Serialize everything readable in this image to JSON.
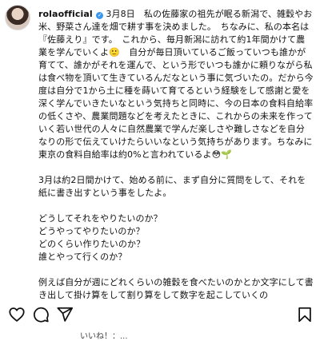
{
  "post": {
    "username": "rolaofficial",
    "date": "3月8日",
    "intro": "私の佐藤家の祖先が眠る新潟で、雑穀やお米、野菜さん達を畑で耕す事を決めました。　ちなみに、私の本名は『佐藤えり』です。　これから、毎月新潟に訪れて約1年間かけて農業を学んでいくよ",
    "emoji_1": "🙂",
    "body": "　自分が毎日頂いているご飯っていつも誰かが育てて、誰かがそれを運んで、という形でいつも誰かに頼りながら私は食べ物を頂いて生きているんだなという事に気づいたの。だから今度は自分で1から土に種を蒔いて育てるという経験をして感謝と愛を深く学んでいきたいなという気持ちと同時に、今の日本の食料自給率の低くさや、農業問題などを考えたときに、これからの未来を作っていく若い世代の人々に自然農業で学んだ楽しさや難しさなどを自分なりの形で伝えていけたらいいなという気持ちがあります。ちなみに東京の食料自給率は約0%と言われているよ",
    "emoji_2": "😳",
    "emoji_3": "🌱",
    "para2": "3月は約2日間かけて、始める前に、まず自分に質問をして、それを紙に書き出すという事をしたよ。",
    "questions": [
      "どうしてそれをやりたいのか？",
      "どうやってやりたいのか？",
      "どのくらい作りたいのか？",
      "誰とやって行くのか？"
    ],
    "para3": "例えば自分が週にどれくらいの雑穀を食べたいのかとか文字にして書き出して掛け算をして割り算をして数字を起こしていくの"
  },
  "actions": {
    "like_icon": "heart-icon",
    "comment_icon": "comment-icon",
    "share_icon": "share-icon",
    "save_icon": "bookmark-icon"
  },
  "likes_text": "いいね！：..."
}
